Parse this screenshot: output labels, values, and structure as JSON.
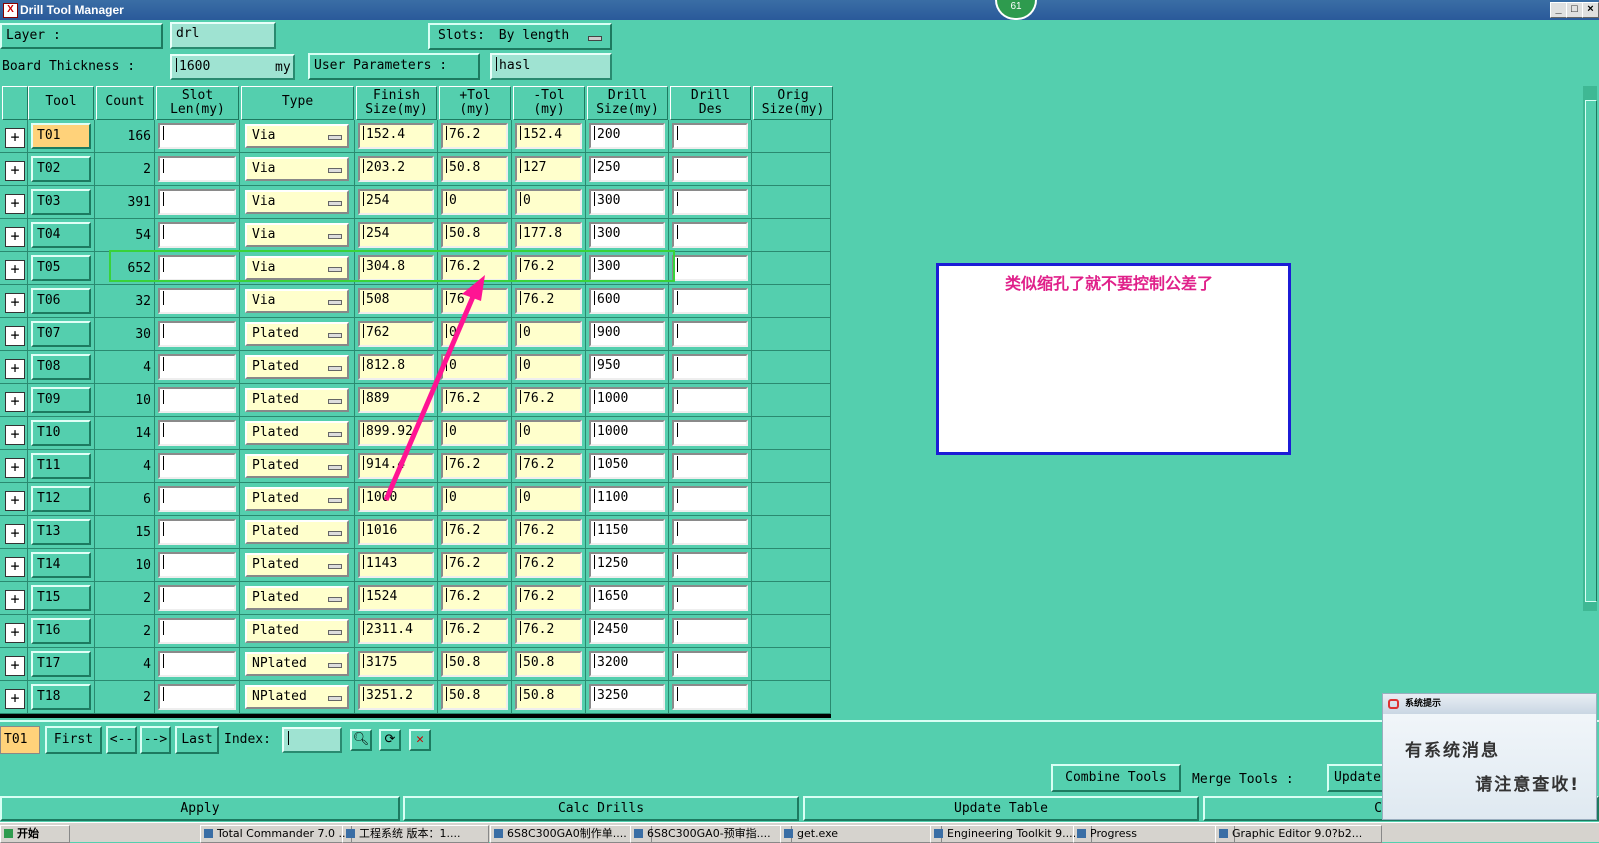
{
  "window": {
    "title": "Drill Tool Manager",
    "badge": "61"
  },
  "controls": {
    "layer_label": "Layer         :",
    "layer_value": "drl",
    "slots_label": "Slots:",
    "slots_value": "By length",
    "thickness_label": "Board Thickness :",
    "thickness_value": "1600",
    "thickness_unit": "my",
    "user_params_label": "User Parameters :",
    "user_params_value": "hasl"
  },
  "columns": [
    "Tool",
    "Count",
    "Slot\nLen(my)",
    "Type",
    "Finish\nSize(my)",
    "+Tol\n(my)",
    "-Tol\n(my)",
    "Drill\nSize(my)",
    "Drill\nDes",
    "Orig\nSize(my)"
  ],
  "rows": [
    {
      "tool": "T01",
      "count": "166",
      "type": "Via",
      "finish": "152.4",
      "ptol": "76.2",
      "mtol": "152.4",
      "drill": "200"
    },
    {
      "tool": "T02",
      "count": "2",
      "type": "Via",
      "finish": "203.2",
      "ptol": "50.8",
      "mtol": "127",
      "drill": "250"
    },
    {
      "tool": "T03",
      "count": "391",
      "type": "Via",
      "finish": "254",
      "ptol": "0",
      "mtol": "0",
      "drill": "300"
    },
    {
      "tool": "T04",
      "count": "54",
      "type": "Via",
      "finish": "254",
      "ptol": "50.8",
      "mtol": "177.8",
      "drill": "300"
    },
    {
      "tool": "T05",
      "count": "652",
      "type": "Via",
      "finish": "304.8",
      "ptol": "76.2",
      "mtol": "76.2",
      "drill": "300"
    },
    {
      "tool": "T06",
      "count": "32",
      "type": "Via",
      "finish": "508",
      "ptol": "76",
      "mtol": "76.2",
      "drill": "600"
    },
    {
      "tool": "T07",
      "count": "30",
      "type": "Plated",
      "finish": "762",
      "ptol": "0",
      "mtol": "0",
      "drill": "900"
    },
    {
      "tool": "T08",
      "count": "4",
      "type": "Plated",
      "finish": "812.8",
      "ptol": "0",
      "mtol": "0",
      "drill": "950"
    },
    {
      "tool": "T09",
      "count": "10",
      "type": "Plated",
      "finish": "889",
      "ptol": "76.2",
      "mtol": "76.2",
      "drill": "1000"
    },
    {
      "tool": "T10",
      "count": "14",
      "type": "Plated",
      "finish": "899.92",
      "ptol": "0",
      "mtol": "0",
      "drill": "1000"
    },
    {
      "tool": "T11",
      "count": "4",
      "type": "Plated",
      "finish": "914.4",
      "ptol": "76.2",
      "mtol": "76.2",
      "drill": "1050"
    },
    {
      "tool": "T12",
      "count": "6",
      "type": "Plated",
      "finish": "1000",
      "ptol": "0",
      "mtol": "0",
      "drill": "1100"
    },
    {
      "tool": "T13",
      "count": "15",
      "type": "Plated",
      "finish": "1016",
      "ptol": "76.2",
      "mtol": "76.2",
      "drill": "1150"
    },
    {
      "tool": "T14",
      "count": "10",
      "type": "Plated",
      "finish": "1143",
      "ptol": "76.2",
      "mtol": "76.2",
      "drill": "1250"
    },
    {
      "tool": "T15",
      "count": "2",
      "type": "Plated",
      "finish": "1524",
      "ptol": "76.2",
      "mtol": "76.2",
      "drill": "1650"
    },
    {
      "tool": "T16",
      "count": "2",
      "type": "Plated",
      "finish": "2311.4",
      "ptol": "76.2",
      "mtol": "76.2",
      "drill": "2450"
    },
    {
      "tool": "T17",
      "count": "4",
      "type": "NPlated",
      "finish": "3175",
      "ptol": "50.8",
      "mtol": "50.8",
      "drill": "3200"
    },
    {
      "tool": "T18",
      "count": "2",
      "type": "NPlated",
      "finish": "3251.2",
      "ptol": "50.8",
      "mtol": "50.8",
      "drill": "3250"
    }
  ],
  "note": {
    "text": "类似缩孔了就不要控制公差了"
  },
  "nav": {
    "current": "T01",
    "first": "First",
    "prev": "<--",
    "next": "-->",
    "last": "Last",
    "index_label": "Index:"
  },
  "actions": {
    "combine": "Combine Tools",
    "merge_label": "Merge Tools :",
    "update": "Update",
    "apply": "Apply",
    "calc": "Calc Drills",
    "update_table": "Update Table",
    "close_partial": "C"
  },
  "popup": {
    "title": "系统提示",
    "line1": "有系统消息",
    "line2": "请注意查收!"
  },
  "taskbar": {
    "start": "开始",
    "items": [
      "Total Commander 7.0 ...",
      "工程系统  版本：1....",
      "6S8C300GA0制作单....",
      "6S8C300GA0-预审指....",
      "get.exe",
      "Engineering Toolkit 9....",
      "Progress",
      "Graphic Editor 9.0?b2..."
    ]
  }
}
